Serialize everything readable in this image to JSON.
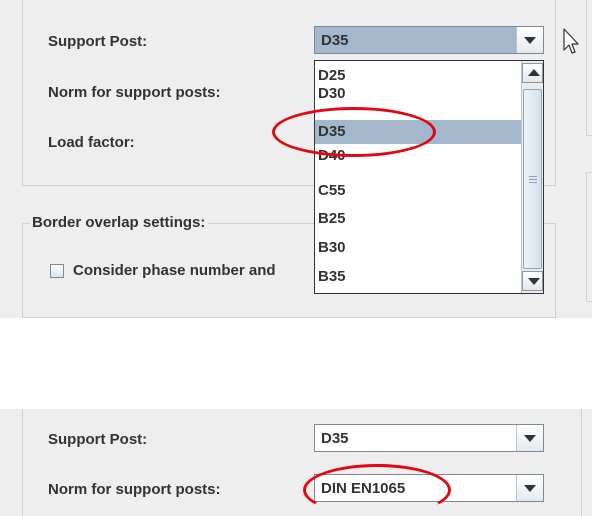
{
  "top_panel": {
    "support_post_label": "Support Post:",
    "support_post_value": "D35",
    "norm_label": "Norm for support posts:",
    "load_factor_label": "Load factor:",
    "border_group_title": "Border overlap settings:",
    "consider_checkbox_label": "Consider phase number and",
    "dropdown_items": [
      "D25",
      "D30",
      "D35",
      "D40",
      "C55",
      "B25",
      "B30",
      "B35"
    ],
    "dropdown_selected": "D35"
  },
  "bottom_panel": {
    "support_post_label": "Support Post:",
    "support_post_value": "D35",
    "norm_label": "Norm for support posts:",
    "norm_value": "DIN EN1065"
  },
  "colors": {
    "highlight": "#e30613",
    "selection": "#a3b8cc",
    "panel_bg": "#eeeeee"
  }
}
